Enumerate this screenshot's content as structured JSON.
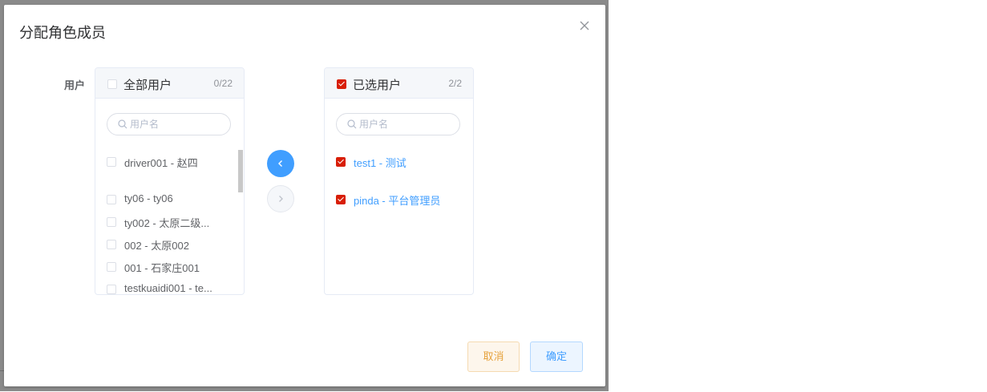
{
  "dialog": {
    "title": "分配角色成员",
    "field_label": "用户",
    "close_icon": "close-icon"
  },
  "left_panel": {
    "title": "全部用户",
    "count": "0/22",
    "all_checked": false,
    "search_placeholder": "用户名",
    "items": [
      {
        "label": "driver001 - 赵四",
        "checked": false
      },
      {
        "label": "ty06 - ty06",
        "checked": false
      },
      {
        "label": "ty002 - 太原二级...",
        "checked": false
      },
      {
        "label": "002 - 太原002",
        "checked": false
      },
      {
        "label": "001 - 石家庄001",
        "checked": false
      },
      {
        "label": "testkuaidi001 - te...",
        "checked": false
      }
    ]
  },
  "right_panel": {
    "title": "已选用户",
    "count": "2/2",
    "all_checked": true,
    "search_placeholder": "用户名",
    "items": [
      {
        "label": "test1 - 测试",
        "checked": true
      },
      {
        "label": "pinda - 平台管理员",
        "checked": true
      }
    ]
  },
  "transfer_buttons": {
    "to_left_icon": "chevron-left-icon",
    "to_right_icon": "chevron-right-icon"
  },
  "footer": {
    "cancel_label": "取消",
    "confirm_label": "确定"
  },
  "colors": {
    "primary": "#409eff",
    "checked": "#d81e06",
    "warning": "#e6a23c"
  }
}
